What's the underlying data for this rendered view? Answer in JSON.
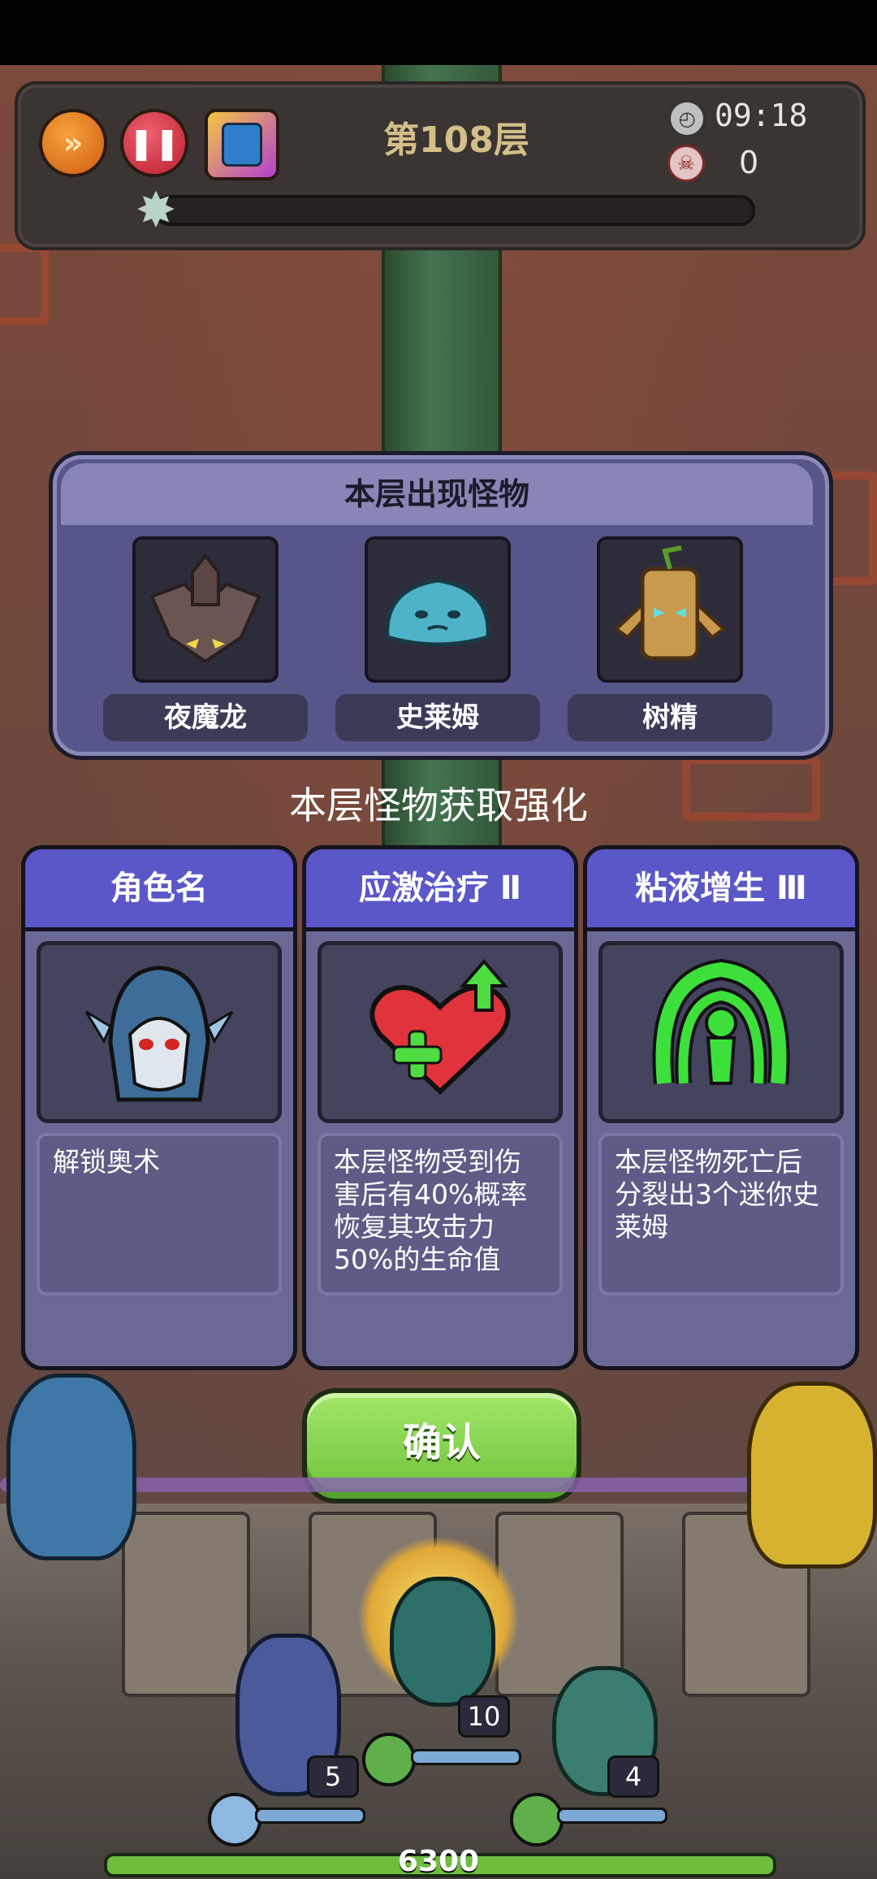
{
  "hud": {
    "floor": "第108层",
    "timer": "09:18",
    "kills": "0",
    "progress": 0.0
  },
  "monster_panel": {
    "title": "本层出现怪物",
    "monsters": [
      {
        "name": "夜魔龙",
        "icon": "bat-dragon-icon"
      },
      {
        "name": "史莱姆",
        "icon": "slime-icon"
      },
      {
        "name": "树精",
        "icon": "treant-icon"
      }
    ]
  },
  "subtitle": "本层怪物获取强化",
  "cards": [
    {
      "title": "角色名",
      "icon": "hooded-elf-portrait",
      "desc": "解锁奥术"
    },
    {
      "title": "应激治疗 Ⅱ",
      "icon": "heart-heal-icon",
      "desc": "本层怪物受到伤害后有40%概率恢复其攻击力50%的生命值"
    },
    {
      "title": "粘液增生 Ⅲ",
      "icon": "slime-split-icon",
      "desc": "本层怪物死亡后分裂出3个迷你史莱姆"
    }
  ],
  "confirm_label": "确认",
  "heroes": {
    "left_level": "5",
    "center_level": "10",
    "right_level": "4",
    "total": "6300"
  },
  "colors": {
    "accent_purple": "#5b57c8",
    "confirm_green": "#8ad452"
  }
}
